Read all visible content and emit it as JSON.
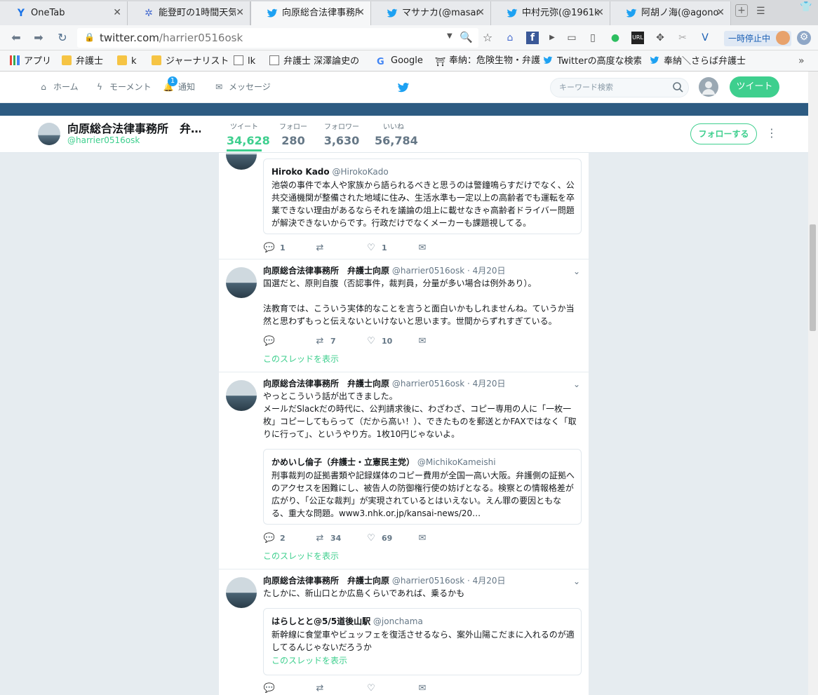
{
  "browser": {
    "tabs": [
      {
        "title": "OneTab",
        "icon": "onetab-icon"
      },
      {
        "title": "能登町の1時間天気",
        "icon": "weather-icon"
      },
      {
        "title": "向原総合法律事務所",
        "icon": "twitter-icon"
      },
      {
        "title": "マサナカ(@masana",
        "icon": "twitter-icon"
      },
      {
        "title": "中村元弥(@1961k",
        "icon": "twitter-icon"
      },
      {
        "title": "阿胡ノ海(@agonou",
        "icon": "twitter-icon"
      }
    ],
    "url_host": "twitter.com",
    "url_path": "/harrier0516osk",
    "pause_label": "一時停止中",
    "bookmarks": [
      {
        "label": "アプリ",
        "type": "apps"
      },
      {
        "label": "弁護士",
        "type": "folder"
      },
      {
        "label": "k",
        "type": "folder"
      },
      {
        "label": "ジャーナリスト",
        "type": "folder"
      },
      {
        "label": "lk",
        "type": "page"
      },
      {
        "label": "弁護士 深澤論史の",
        "type": "page"
      },
      {
        "label": "Google",
        "type": "google"
      },
      {
        "label": "奉納：危険生物・弁護",
        "type": "page"
      },
      {
        "label": "Twitterの高度な検索",
        "type": "twitter"
      },
      {
        "label": "奉納＼さらば弁護士",
        "type": "twitter"
      }
    ]
  },
  "nav": {
    "home": "ホーム",
    "moments": "モーメント",
    "notifications": "通知",
    "notif_count": "1",
    "messages": "メッセージ",
    "search_placeholder": "キーワード検索",
    "tweet_button": "ツイート"
  },
  "profile": {
    "name": "向原総合法律事務所　弁…",
    "handle": "@harrier0516osk",
    "stats": [
      {
        "label": "ツイート",
        "value": "34,628"
      },
      {
        "label": "フォロー",
        "value": "280"
      },
      {
        "label": "フォロワー",
        "value": "3,630"
      },
      {
        "label": "いいね",
        "value": "56,784"
      }
    ],
    "follow_button": "フォローする"
  },
  "tweets": [
    {
      "quote": {
        "name": "Hiroko Kado",
        "handle": "@HirokoKado",
        "text": "池袋の事件で本人や家族から語られるべきと思うのは警鐘鳴らすだけでなく、公共交通機関が整備された地域に住み、生活水準も一定以上の高齢者でも運転を卒業できない理由があるならそれを議論の俎上に載せなきゃ高齢者ドライバー問題が解決できないからです。行政だけでなくメーカーも課題視してる。"
      },
      "reply": "1",
      "retweet": "",
      "like": "1"
    },
    {
      "name": "向原総合法律事務所　弁護士向原",
      "handle": "@harrier0516osk · 4月20日",
      "text": "国選だと、原則自腹（否認事件，裁判員，分量が多い場合は例外あり）。\n\n法教育では、こういう実体的なことを言うと面白いかもしれませんね。ていうか当然と思わずもっと伝えないといけないと思います。世間からずれすぎている。",
      "reply": "",
      "retweet": "7",
      "like": "10",
      "thread": "このスレッドを表示"
    },
    {
      "name": "向原総合法律事務所　弁護士向原",
      "handle": "@harrier0516osk · 4月20日",
      "text": "やっとこういう話が出てきました。\nメールだSlackだの時代に、公判請求後に、わざわざ、コピー専用の人に「一枚一枚」コピーしてもらって（だから高い！）、できたものを郵送とかFAXではなく「取りに行って」、というやり方。1枚10円じゃないよ。",
      "quote": {
        "name": "かめいし倫子（弁護士・立憲民主党）",
        "handle": "@MichikoKameishi",
        "text": "刑事裁判の証拠書類や記録媒体のコピー費用が全国一高い大阪。弁護側の証拠へのアクセスを困難にし、被告人の防御権行使の妨げとなる。検察との情報格差が広がり、「公正な裁判」が実現されているとはいえない。えん罪の要因ともなる、重大な問題。www3.nhk.or.jp/kansai-news/20…"
      },
      "reply": "2",
      "retweet": "34",
      "like": "69",
      "thread": "このスレッドを表示"
    },
    {
      "name": "向原総合法律事務所　弁護士向原",
      "handle": "@harrier0516osk · 4月20日",
      "text": "たしかに、新山口とか広島くらいであれば、乗るかも",
      "quote": {
        "name": "はらしとと@5/5道後山駅",
        "handle": "@jonchama",
        "text": "新幹線に食堂車やビュッフェを復活させるなら、案外山陽こだまに入れるのが適してるんじゃないだろうか",
        "thread": "このスレッドを表示"
      },
      "reply": "",
      "retweet": "",
      "like": ""
    }
  ]
}
